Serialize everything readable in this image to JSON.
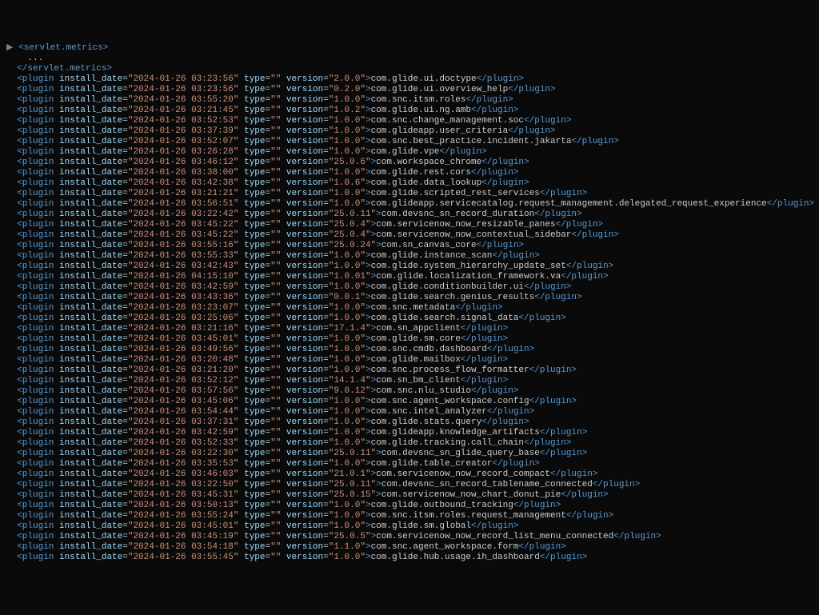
{
  "header": {
    "opening_tag": "servlet.metrics",
    "ellipsis": "...",
    "closing_tag": "servlet.metrics"
  },
  "plugins": [
    {
      "date": "2024-01-26 03:23:56",
      "version": "2.0.0",
      "name": "com.glide.ui.doctype"
    },
    {
      "date": "2024-01-26 03:23:56",
      "version": "0.2.0",
      "name": "com.glide.ui.overview_help"
    },
    {
      "date": "2024-01-26 03:55:20",
      "version": "1.0.0",
      "name": "com.snc.itsm.roles"
    },
    {
      "date": "2024-01-26 03:21:45",
      "version": "1.0.2",
      "name": "com.glide.ui.ng.amb"
    },
    {
      "date": "2024-01-26 03:52:53",
      "version": "1.0.0",
      "name": "com.snc.change_management.soc"
    },
    {
      "date": "2024-01-26 03:37:39",
      "version": "1.0.0",
      "name": "com.glideapp.user_criteria"
    },
    {
      "date": "2024-01-26 03:52:07",
      "version": "1.0.0",
      "name": "com.snc.best_practice.incident.jakarta"
    },
    {
      "date": "2024-01-26 03:26:28",
      "version": "1.0.0",
      "name": "com.glide.vpe"
    },
    {
      "date": "2024-01-26 03:46:12",
      "version": "25.0.6",
      "name": "com.workspace_chrome"
    },
    {
      "date": "2024-01-26 03:38:00",
      "version": "1.0.0",
      "name": "com.glide.rest.cors"
    },
    {
      "date": "2024-01-26 03:42:38",
      "version": "1.0.6",
      "name": "com.glide.data_lookup"
    },
    {
      "date": "2024-01-26 03:21:21",
      "version": "1.0.0",
      "name": "com.glide.scripted_rest_services"
    },
    {
      "date": "2024-01-26 03:56:51",
      "version": "1.0.0",
      "name": "com.glideapp.servicecatalog.request_management.delegated_request_experience"
    },
    {
      "date": "2024-01-26 03:22:42",
      "version": "25.0.11",
      "name": "com.devsnc_sn_record_duration"
    },
    {
      "date": "2024-01-26 03:45:22",
      "version": "25.0.4",
      "name": "com.servicenow_now_resizable_panes"
    },
    {
      "date": "2024-01-26 03:45:22",
      "version": "25.0.4",
      "name": "com.servicenow_now_contextual_sidebar"
    },
    {
      "date": "2024-01-26 03:55:16",
      "version": "25.0.24",
      "name": "com.sn_canvas_core"
    },
    {
      "date": "2024-01-26 03:55:33",
      "version": "1.0.0",
      "name": "com.glide.instance_scan"
    },
    {
      "date": "2024-01-26 03:42:43",
      "version": "1.0.0",
      "name": "com.glide.system_hierarchy_update_set"
    },
    {
      "date": "2024-01-26 04:15:10",
      "version": "1.0.01",
      "name": "com.glide.localization_framework.va"
    },
    {
      "date": "2024-01-26 03:42:59",
      "version": "1.0.0",
      "name": "com.glide.conditionbuilder.ui"
    },
    {
      "date": "2024-01-26 03:43:36",
      "version": "0.0.1",
      "name": "com.glide.search.genius_results"
    },
    {
      "date": "2024-01-26 03:23:07",
      "version": "1.0.0",
      "name": "com.snc.metadata"
    },
    {
      "date": "2024-01-26 03:25:06",
      "version": "1.0.0",
      "name": "com.glide.search.signal_data"
    },
    {
      "date": "2024-01-26 03:21:16",
      "version": "17.1.4",
      "name": "com.sn_appclient"
    },
    {
      "date": "2024-01-26 03:45:01",
      "version": "1.0.0",
      "name": "com.glide.sm.core"
    },
    {
      "date": "2024-01-26 03:49:56",
      "version": "1.0.0",
      "name": "com.snc.cmdb.dashboard"
    },
    {
      "date": "2024-01-26 03:20:48",
      "version": "1.0.0",
      "name": "com.glide.mailbox"
    },
    {
      "date": "2024-01-26 03:21:20",
      "version": "1.0.0",
      "name": "com.snc.process_flow_formatter"
    },
    {
      "date": "2024-01-26 03:52:12",
      "version": "14.1.4",
      "name": "com.sn_bm_client"
    },
    {
      "date": "2024-01-26 03:57:56",
      "version": "9.0.12",
      "name": "com.snc.nlu_studio"
    },
    {
      "date": "2024-01-26 03:45:06",
      "version": "1.0.0",
      "name": "com.snc.agent_workspace.config"
    },
    {
      "date": "2024-01-26 03:54:44",
      "version": "1.0.0",
      "name": "com.snc.intel_analyzer"
    },
    {
      "date": "2024-01-26 03:37:31",
      "version": "1.0.0",
      "name": "com.glide.stats.query"
    },
    {
      "date": "2024-01-26 03:42:59",
      "version": "1.0.0",
      "name": "com.glideapp.knowledge_artifacts"
    },
    {
      "date": "2024-01-26 03:52:33",
      "version": "1.0.0",
      "name": "com.glide.tracking.call_chain"
    },
    {
      "date": "2024-01-26 03:22:30",
      "version": "25.0.11",
      "name": "com.devsnc_sn_glide_query_base"
    },
    {
      "date": "2024-01-26 03:35:53",
      "version": "1.0.0",
      "name": "com.glide.table_creator"
    },
    {
      "date": "2024-01-26 03:46:03",
      "version": "21.0.1",
      "name": "com.servicenow_now_record_compact"
    },
    {
      "date": "2024-01-26 03:22:50",
      "version": "25.0.11",
      "name": "com.devsnc_sn_record_tablename_connected"
    },
    {
      "date": "2024-01-26 03:45:31",
      "version": "25.0.15",
      "name": "com.servicenow_now_chart_donut_pie"
    },
    {
      "date": "2024-01-26 03:50:13",
      "version": "1.0.0",
      "name": "com.glide.outbound_tracking"
    },
    {
      "date": "2024-01-26 03:55:24",
      "version": "1.0.0",
      "name": "com.snc.itsm.roles.request_management"
    },
    {
      "date": "2024-01-26 03:45:01",
      "version": "1.0.0",
      "name": "com.glide.sm.global"
    },
    {
      "date": "2024-01-26 03:45:19",
      "version": "25.0.5",
      "name": "com.servicenow_now_record_list_menu_connected"
    },
    {
      "date": "2024-01-26 03:54:18",
      "version": "1.1.0",
      "name": "com.snc.agent_workspace.form"
    },
    {
      "date": "2024-01-26 03:55:45",
      "version": "1.0.0",
      "name": "com.glide.hub.usage.ih_dashboard"
    }
  ]
}
